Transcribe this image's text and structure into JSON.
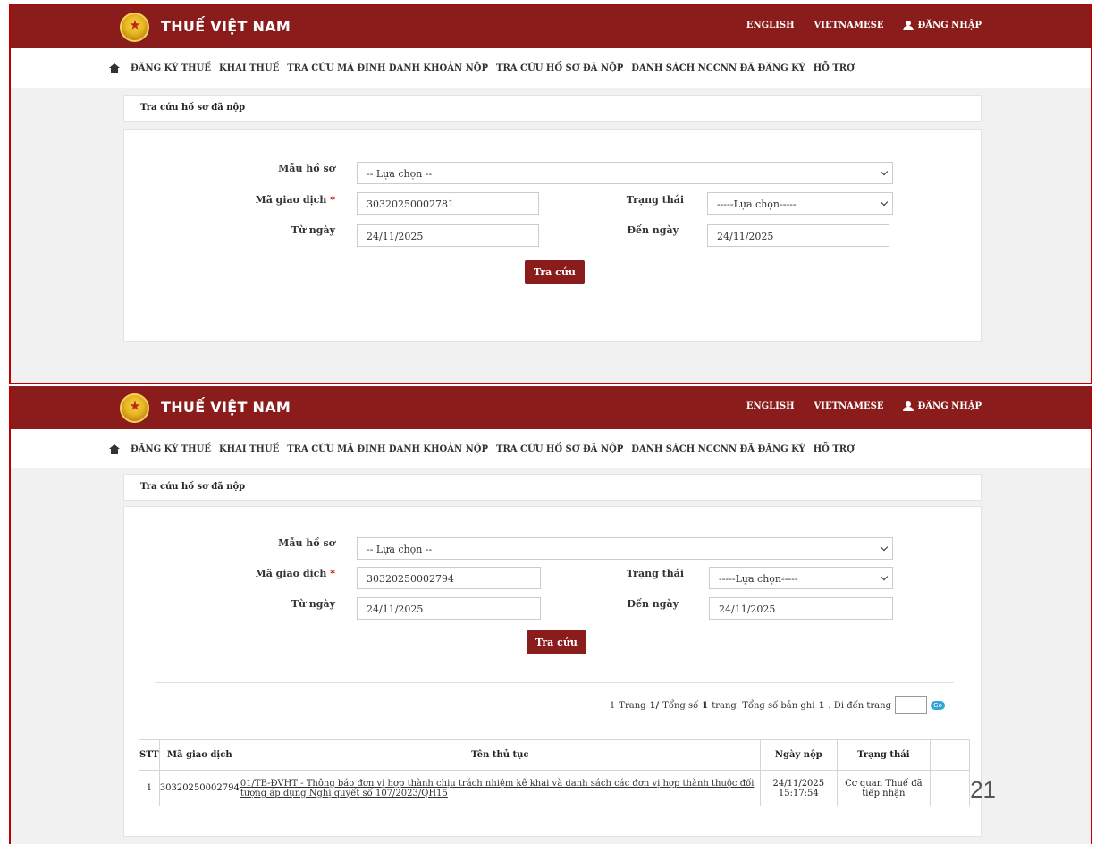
{
  "header": {
    "brand": "THUẾ VIỆT NAM",
    "lang_english": "ENGLISH",
    "lang_vietnamese": "VIETNAMESE",
    "login": "ĐĂNG NHẬP"
  },
  "nav": {
    "items": [
      "ĐĂNG KÝ THUẾ",
      "KHAI THUẾ",
      "TRA CỨU MÃ ĐỊNH DANH KHOẢN NỘP",
      "TRA CỨU HỒ SƠ ĐÃ NỘP",
      "DANH SÁCH NCCNN ĐÃ ĐĂNG KÝ",
      "HỖ TRỢ"
    ]
  },
  "page_title": "Tra cứu hồ sơ đã nộp",
  "form": {
    "mau_ho_so_label": "Mẫu hồ sơ",
    "mau_ho_so_value": "-- Lựa chọn --",
    "ma_giao_dich_label": "Mã giao dịch",
    "required_mark": "*",
    "trang_thai_label": "Trạng thái",
    "trang_thai_value": "-----Lựa chọn-----",
    "tu_ngay_label": "Từ ngày",
    "den_ngay_label": "Đến ngày",
    "submit_label": "Tra cứu"
  },
  "screen1": {
    "ma_giao_dich_value": "30320250002781",
    "tu_ngay_value": "24/11/2025",
    "den_ngay_value": "24/11/2025"
  },
  "screen2": {
    "ma_giao_dich_value": "30320250002794",
    "tu_ngay_value": "24/11/2025",
    "den_ngay_value": "24/11/2025",
    "pager": {
      "first": "1",
      "trang": "Trang",
      "page_current": "1/",
      "tong_so": "Tổng số",
      "total_pages": "1",
      "trang_dot": "trang. Tổng số bản ghi",
      "total_records": "1",
      "goto": ". Đi đến trang",
      "go": "Go"
    },
    "table": {
      "headers": [
        "STT",
        "Mã giao dịch",
        "Tên thủ tục",
        "Ngày nộp",
        "Trạng thái",
        ""
      ],
      "rows": [
        {
          "stt": "1",
          "ma_giao_dich": "30320250002794",
          "ten_thu_tuc": "01/TB-ĐVHT - Thông báo đơn vị hợp thành chịu trách nhiệm kê khai và danh sách các đơn vị hợp thành thuộc đối tượng áp dụng Nghị quyết số 107/2023/QH15",
          "ngay_nop_date": "24/11/2025",
          "ngay_nop_time": "15:17:54",
          "trang_thai": "Cơ quan Thuế đã tiếp nhận"
        }
      ]
    }
  },
  "slide_page_number": "21"
}
